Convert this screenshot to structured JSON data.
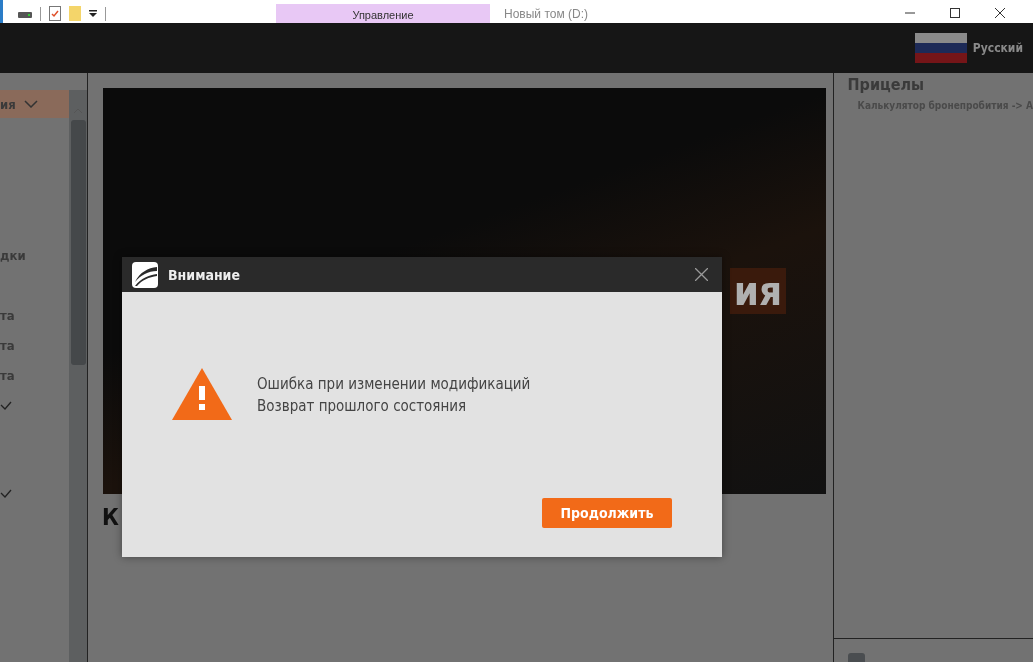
{
  "explorer": {
    "ribbon_tab": "Управление",
    "title": "Новый том  (D:)"
  },
  "header": {
    "language": "Русский"
  },
  "sidebar": {
    "items": [
      {
        "kind": "dropdown",
        "label": "ия",
        "selected": true
      },
      {
        "kind": "text",
        "label": "дки",
        "selected": false
      },
      {
        "kind": "text",
        "label": "та",
        "selected": false
      },
      {
        "kind": "text",
        "label": "та",
        "selected": false
      },
      {
        "kind": "text",
        "label": "та",
        "selected": false
      },
      {
        "kind": "check",
        "checked": true
      },
      {
        "kind": "check",
        "checked": true
      }
    ]
  },
  "main": {
    "banner_text": "ия",
    "heading": "К"
  },
  "right_panel": {
    "title": "Прицелы",
    "link": "Калькулятор бронепробития -> А",
    "checkbox": {
      "checked": false
    }
  },
  "dialog": {
    "title": "Внимание",
    "lines": [
      "Ошибка при изменении модификаций",
      "Возврат прошлого состояния"
    ],
    "button": "Продолжить"
  }
}
